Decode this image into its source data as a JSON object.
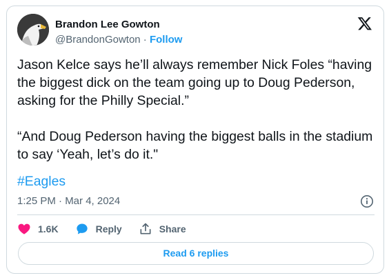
{
  "author": {
    "name": "Brandon Lee Gowton",
    "handle": "@BrandonGowton",
    "separator": " · ",
    "follow_label": "Follow"
  },
  "platform_icon": "x-logo-icon",
  "tweet": {
    "paragraph_1": "Jason Kelce says he’ll always remember Nick Foles “having the biggest dick on the team going up to Doug Pederson, asking for the Philly Special.”",
    "paragraph_2": "“And Doug Pederson having the biggest balls in the stadium to say ‘Yeah, let’s do it.\"",
    "hashtag": "#Eagles",
    "timestamp": "1:25 PM · Mar 4, 2024"
  },
  "actions": {
    "like_count": "1.6K",
    "reply_label": "Reply",
    "share_label": "Share"
  },
  "read_replies_label": "Read 6 replies",
  "colors": {
    "accent": "#1d9bf0",
    "like": "#f91880",
    "text": "#0f1419",
    "muted": "#536471",
    "border": "#cfd9de"
  }
}
